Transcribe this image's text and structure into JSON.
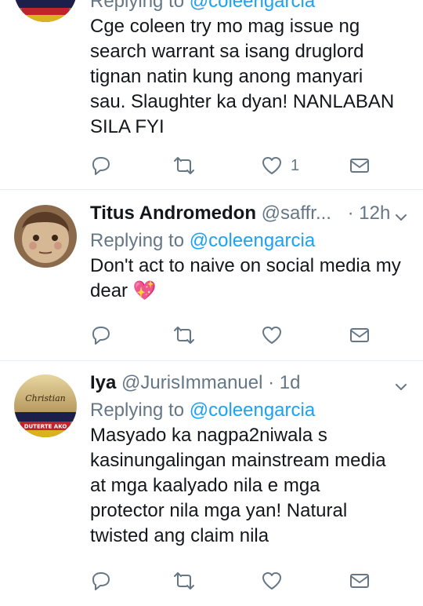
{
  "tweets": [
    {
      "reply_prefix": "Replying to",
      "reply_handle": "@coleengarcia",
      "lines": [
        "Cge coleen try mo mag issue ng",
        "search warrant sa isang druglord",
        "tignan natin kung anong manyari",
        "sau. Slaughter ka dyan! NANLABAN",
        "SILA FYI"
      ],
      "like_count": "1"
    },
    {
      "name": "Titus Andromedon",
      "handle": "@saffr...",
      "time": "· 12h",
      "reply_prefix": "Replying to",
      "reply_handle": "@coleengarcia",
      "lines": [
        "Don't act to naive on social media my",
        "dear 💖"
      ]
    },
    {
      "name": "Iya",
      "handle": "@JurisImmanuel",
      "time": "· 1d",
      "reply_prefix": "Replying to",
      "reply_handle": "@coleengarcia",
      "lines": [
        "Masyado ka nagpa2niwala s",
        "kasinungalingan mainstream media",
        "at mga kaalyado nila e mga",
        "protector nila mga yan! Natural",
        "twisted ang claim nila"
      ],
      "avatar_text_script": "Christian",
      "avatar_text_banner": "DUTERTE AKO"
    }
  ],
  "colors": {
    "accent": "#1da1f2",
    "muted": "#657786",
    "text": "#14171a",
    "divider": "#e6ecf0"
  },
  "icons": [
    "reply-icon",
    "retweet-icon",
    "like-icon",
    "message-icon",
    "chevron-down-icon"
  ]
}
